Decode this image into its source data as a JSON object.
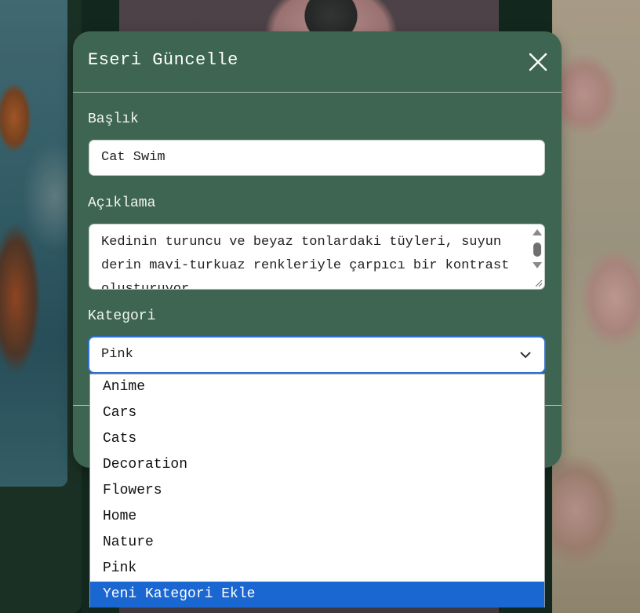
{
  "modal": {
    "title": "Eseri Güncelle",
    "fields": {
      "title_label": "Başlık",
      "title_value": "Cat Swim",
      "description_label": "Açıklama",
      "description_value": "Kedinin turuncu ve beyaz tonlardaki tüyleri, suyun derin mavi-turkuaz renkleriyle çarpıcı bir kontrast oluşturuyor.",
      "category_label": "Kategori",
      "category_value": "Pink"
    }
  },
  "dropdown": {
    "options": [
      "Anime",
      "Cars",
      "Cats",
      "Decoration",
      "Flowers",
      "Home",
      "Nature",
      "Pink",
      "Yeni Kategori Ekle"
    ],
    "highlighted": "Yeni Kategori Ekle"
  },
  "colors": {
    "modal_bg": "#3e6552",
    "highlight": "#1b67d1",
    "focus_border": "#2f6fcf"
  },
  "icons": {
    "close": "close-icon",
    "chevron": "chevron-down-icon"
  }
}
